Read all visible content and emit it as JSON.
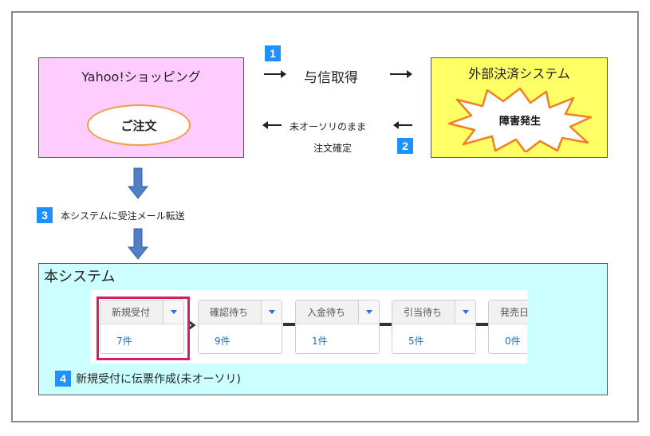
{
  "yahoo": {
    "title": "Yahoo!ショッピング",
    "order": "ご注文"
  },
  "external": {
    "title": "外部決済システム",
    "failure": "障害発生"
  },
  "step1": {
    "num": "1",
    "label": "与信取得"
  },
  "step2": {
    "num": "2",
    "line1": "未オーソリのまま",
    "line2": "注文確定"
  },
  "step3": {
    "num": "3",
    "label": "本システムに受注メール転送"
  },
  "system": {
    "title": "本システム",
    "columns": [
      {
        "label": "新規受付",
        "count": "7件"
      },
      {
        "label": "確認待ち",
        "count": "9件"
      },
      {
        "label": "入金待ち",
        "count": "1件"
      },
      {
        "label": "引当待ち",
        "count": "5件"
      },
      {
        "label": "発売日",
        "count": "0件"
      }
    ],
    "step4": {
      "num": "4",
      "label": "新規受付に伝票作成(未オーソリ)"
    }
  },
  "colors": {
    "badge": "#1e90ff",
    "highlight": "#cc2266",
    "yahoo_bg": "#ffccff",
    "external_bg": "#ffff66",
    "system_bg": "#ccffff",
    "arrow_blue": "#4f7fc4"
  }
}
